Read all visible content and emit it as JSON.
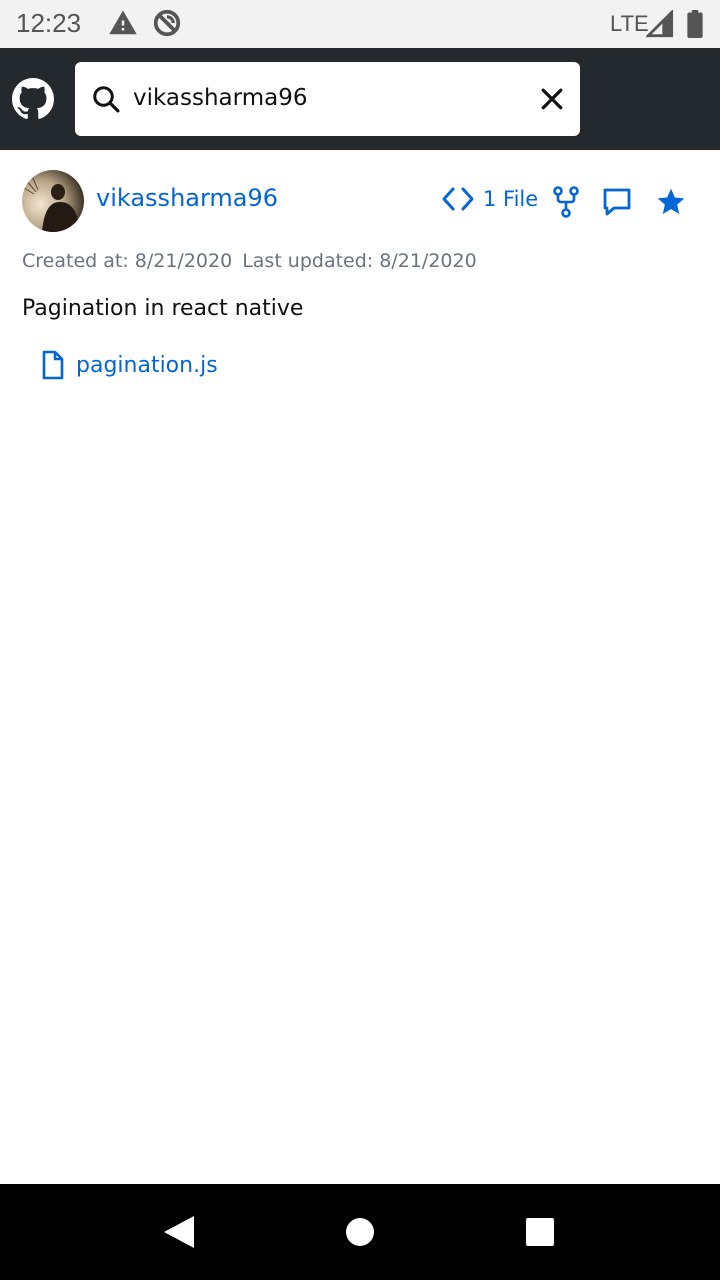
{
  "status_bar": {
    "time": "12:23",
    "network": "LTE",
    "icons": [
      "warning-icon",
      "sync-disabled-icon",
      "signal-icon",
      "battery-icon"
    ]
  },
  "header": {
    "logo": "github-logo",
    "search": {
      "value": "vikassharma96",
      "icon": "search-icon",
      "clear_icon": "close-icon"
    }
  },
  "gist": {
    "owner": "vikassharma96",
    "files_count_label": "1 File",
    "created": "Created at: 8/21/2020",
    "updated": "Last updated: 8/21/2020",
    "description": "Pagination in react native",
    "files": [
      {
        "name": "pagination.js",
        "icon": "file-icon"
      }
    ]
  },
  "colors": {
    "header_bg": "#24292e",
    "link": "#0366d6",
    "meta_text": "#6a737d",
    "status_bar_bg": "#f2f2f2",
    "nav_bar_bg": "#000000"
  },
  "nav_bar": {
    "buttons": [
      "back-icon",
      "home-icon",
      "recent-apps-icon"
    ]
  }
}
